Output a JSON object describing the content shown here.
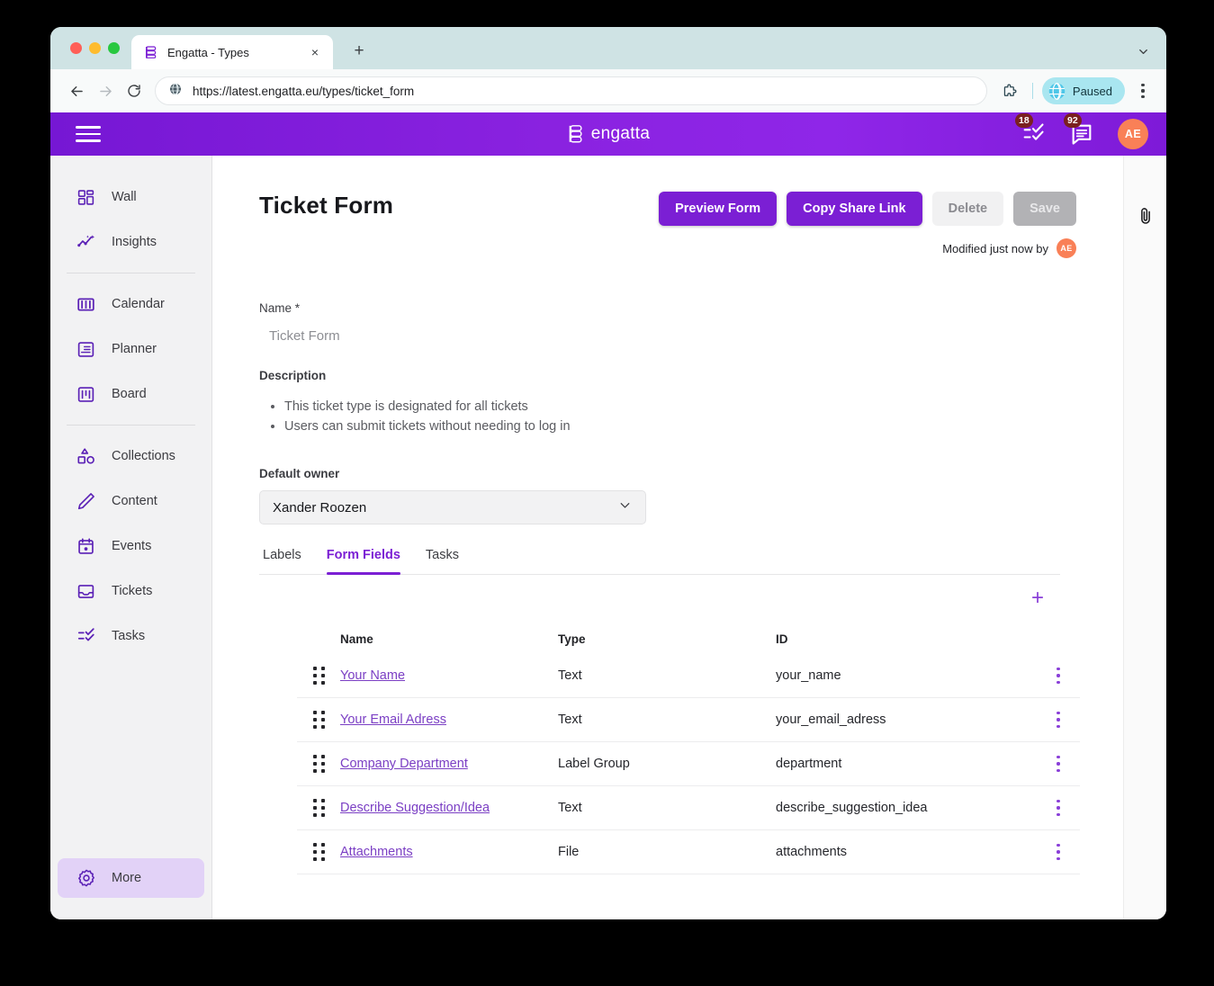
{
  "browser": {
    "tab": {
      "title": "Engatta - Types",
      "favicon": "engatta-logo-icon",
      "close": "×"
    },
    "new_tab": "+",
    "url": "https://latest.engatta.eu/types/ticket_form",
    "paused_label": "Paused",
    "nav": {
      "back": "back-icon",
      "forward": "forward-icon",
      "reload": "reload-icon"
    }
  },
  "app_header": {
    "logo_text": "engatta",
    "tasks_badge": "18",
    "messages_badge": "92",
    "avatar_initials": "AE"
  },
  "sidebar": {
    "items": [
      {
        "label": "Wall",
        "icon": "grid-icon",
        "active": false
      },
      {
        "label": "Insights",
        "icon": "chart-line-icon",
        "active": false
      },
      {
        "label": "Calendar",
        "icon": "calendar-columns-icon",
        "active": false
      },
      {
        "label": "Planner",
        "icon": "planner-icon",
        "active": false
      },
      {
        "label": "Board",
        "icon": "board-icon",
        "active": false
      },
      {
        "label": "Collections",
        "icon": "shapes-icon",
        "active": false
      },
      {
        "label": "Content",
        "icon": "pencil-icon",
        "active": false
      },
      {
        "label": "Events",
        "icon": "calendar-dot-icon",
        "active": false
      },
      {
        "label": "Tickets",
        "icon": "tray-icon",
        "active": false
      },
      {
        "label": "Tasks",
        "icon": "checklist-icon",
        "active": false
      }
    ],
    "more": {
      "label": "More",
      "icon": "gear-icon",
      "active": true
    }
  },
  "main": {
    "page_title": "Ticket Form",
    "buttons": {
      "preview": "Preview Form",
      "copy_share_link": "Copy Share Link",
      "delete": "Delete",
      "save": "Save"
    },
    "modified_text": "Modified just now by",
    "modified_avatar": "AE",
    "name_label": "Name *",
    "name_value": "Ticket Form",
    "description_label": "Description",
    "description_items": [
      "This ticket type is designated for all tickets",
      "Users can submit tickets without needing to log in"
    ],
    "owner_label": "Default owner",
    "owner_value": "Xander Roozen",
    "tabs": [
      {
        "label": "Labels",
        "active": false
      },
      {
        "label": "Form Fields",
        "active": true
      },
      {
        "label": "Tasks",
        "active": false
      }
    ],
    "add_field": "+",
    "table": {
      "headers": {
        "name": "Name",
        "type": "Type",
        "id": "ID"
      },
      "rows": [
        {
          "name": "Your Name",
          "type": "Text",
          "id": "your_name"
        },
        {
          "name": "Your Email Adress",
          "type": "Text",
          "id": "your_email_adress"
        },
        {
          "name": "Company Department",
          "type": "Label Group",
          "id": "department"
        },
        {
          "name": "Describe Suggestion/Idea",
          "type": "Text",
          "id": "describe_suggestion_idea"
        },
        {
          "name": "Attachments",
          "type": "File",
          "id": "attachments"
        }
      ]
    }
  },
  "right_rail": {
    "attachment_icon": "paperclip-icon"
  },
  "colors": {
    "brand_purple": "#7b1fd4",
    "header_gradient_start": "#7617d4",
    "header_gradient_end": "#7e1ad8",
    "avatar_orange": "#f98057",
    "badge_dark_red": "#7a2020",
    "sidebar_bg": "#f2f2f3",
    "active_nav_bg": "#e2d2f7",
    "link_purple": "#7b3fc4"
  }
}
